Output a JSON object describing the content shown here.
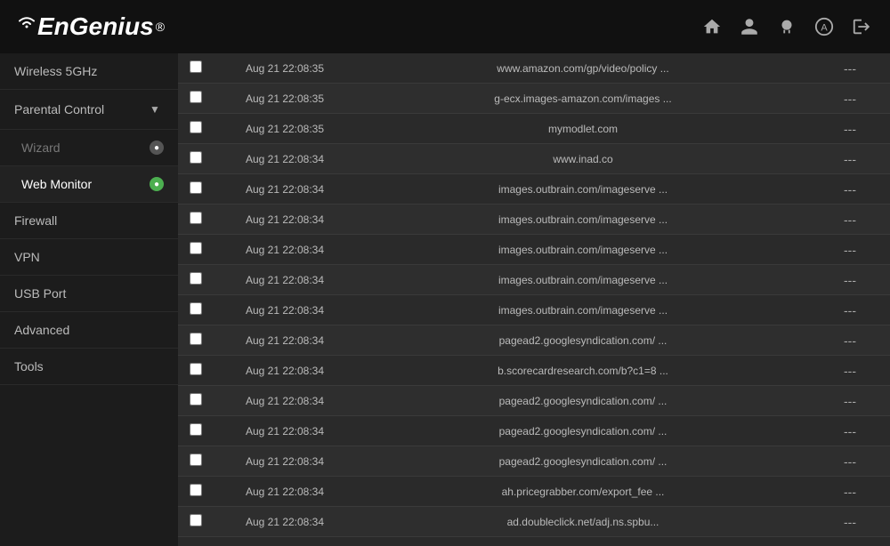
{
  "header": {
    "logo_text": "EnGenius",
    "icons": [
      "home",
      "user",
      "sheep",
      "letter-a",
      "logout"
    ]
  },
  "sidebar": {
    "items": [
      {
        "id": "wireless-5ghz",
        "label": "Wireless 5GHz",
        "icon": null,
        "active": false
      },
      {
        "id": "parental-control",
        "label": "Parental Control",
        "icon": "arrow-down",
        "active": false
      },
      {
        "id": "wizard",
        "label": "Wizard",
        "icon": "gray-dot",
        "active": false
      },
      {
        "id": "web-monitor",
        "label": "Web Monitor",
        "icon": "green-dot",
        "active": true
      },
      {
        "id": "firewall",
        "label": "Firewall",
        "icon": null,
        "active": false
      },
      {
        "id": "vpn",
        "label": "VPN",
        "icon": null,
        "active": false
      },
      {
        "id": "usb-port",
        "label": "USB Port",
        "icon": null,
        "active": false
      },
      {
        "id": "advanced",
        "label": "Advanced",
        "icon": null,
        "active": false
      },
      {
        "id": "tools",
        "label": "Tools",
        "icon": null,
        "active": false
      }
    ]
  },
  "table": {
    "rows": [
      {
        "timestamp": "Aug 21 22:08:35",
        "url": "www.amazon.com/gp/video/policy ...",
        "value": "---"
      },
      {
        "timestamp": "Aug 21 22:08:35",
        "url": "g-ecx.images-amazon.com/images ...",
        "value": "---"
      },
      {
        "timestamp": "Aug 21 22:08:35",
        "url": "mymodlet.com",
        "value": "---"
      },
      {
        "timestamp": "Aug 21 22:08:34",
        "url": "www.inad.co",
        "value": "---"
      },
      {
        "timestamp": "Aug 21 22:08:34",
        "url": "images.outbrain.com/imageserve ...",
        "value": "---"
      },
      {
        "timestamp": "Aug 21 22:08:34",
        "url": "images.outbrain.com/imageserve ...",
        "value": "---"
      },
      {
        "timestamp": "Aug 21 22:08:34",
        "url": "images.outbrain.com/imageserve ...",
        "value": "---"
      },
      {
        "timestamp": "Aug 21 22:08:34",
        "url": "images.outbrain.com/imageserve ...",
        "value": "---"
      },
      {
        "timestamp": "Aug 21 22:08:34",
        "url": "images.outbrain.com/imageserve ...",
        "value": "---"
      },
      {
        "timestamp": "Aug 21 22:08:34",
        "url": "pagead2.googlesyndication.com/ ...",
        "value": "---"
      },
      {
        "timestamp": "Aug 21 22:08:34",
        "url": "b.scorecardresearch.com/b?c1=8 ...",
        "value": "---"
      },
      {
        "timestamp": "Aug 21 22:08:34",
        "url": "pagead2.googlesyndication.com/ ...",
        "value": "---"
      },
      {
        "timestamp": "Aug 21 22:08:34",
        "url": "pagead2.googlesyndication.com/ ...",
        "value": "---"
      },
      {
        "timestamp": "Aug 21 22:08:34",
        "url": "pagead2.googlesyndication.com/ ...",
        "value": "---"
      },
      {
        "timestamp": "Aug 21 22:08:34",
        "url": "ah.pricegrabber.com/export_fee ...",
        "value": "---"
      },
      {
        "timestamp": "Aug 21 22:08:34",
        "url": "ad.doubleclick.net/adj.ns.spbu...",
        "value": "---"
      }
    ]
  }
}
